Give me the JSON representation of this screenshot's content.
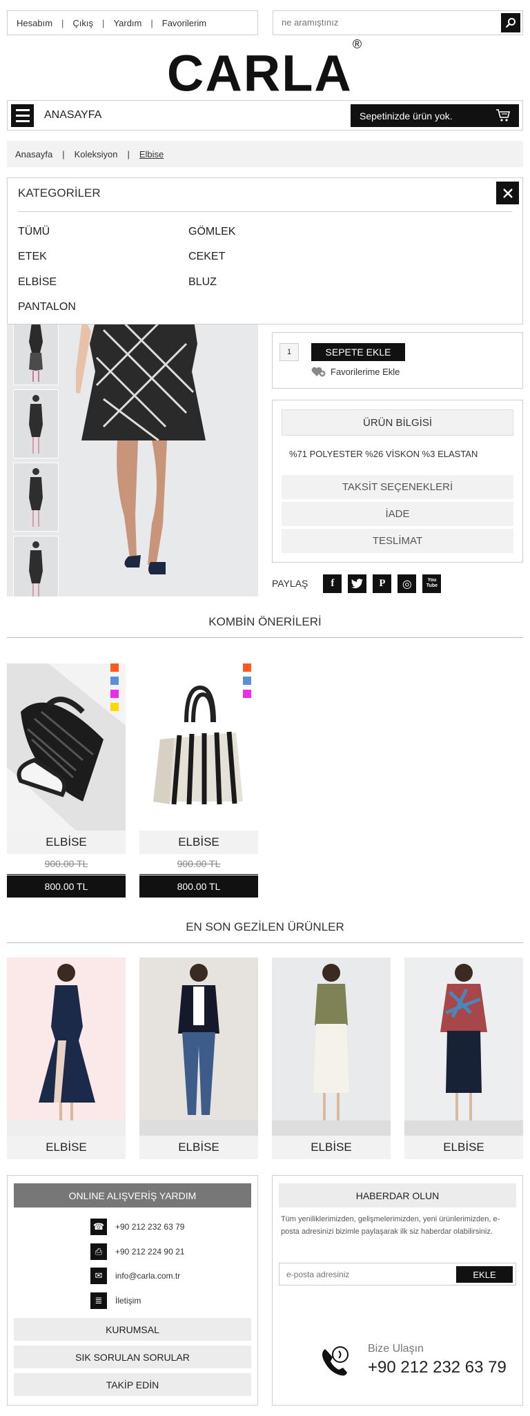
{
  "topnav": {
    "items": [
      "Hesabım",
      "Çıkış",
      "Yardım",
      "Favorilerim"
    ]
  },
  "search": {
    "placeholder": "ne aramıştınız"
  },
  "brand": {
    "logo": "CARLA",
    "reg": "®"
  },
  "navbar": {
    "home": "ANASAYFA",
    "cart": "Sepetinizde ürün yok."
  },
  "breadcrumb": {
    "items": [
      "Anasayfa",
      "Koleksiyon",
      "Elbise"
    ]
  },
  "categories": {
    "title": "KATEGORİLER",
    "items": [
      "TÜMÜ",
      "GÖMLEK",
      "ETEK",
      "CEKET",
      "ELBİSE",
      "BLUZ",
      "PANTALON"
    ]
  },
  "buy": {
    "qty": "1",
    "add": "SEPETE EKLE",
    "fav": "Favorilerime Ekle"
  },
  "info": {
    "title": "ÜRÜN BİLGİSİ",
    "composition": "%71 POLYESTER %26 VİSKON %3 ELASTAN",
    "rows": [
      "TAKSİT SEÇENEKLERİ",
      "İADE",
      "TESLİMAT"
    ]
  },
  "share": {
    "label": "PAYLAŞ",
    "icons": [
      "f",
      "t",
      "P",
      "◎",
      "You Tube"
    ]
  },
  "combo": {
    "title": "KOMBİN ÖNERİLERİ",
    "products": [
      {
        "name": "ELBİSE",
        "old_price": "900.00 TL",
        "price": "800.00 TL",
        "swatches": [
          "#ff5a1f",
          "#5b8fd6",
          "#e92ee9",
          "#ffd800"
        ]
      },
      {
        "name": "ELBİSE",
        "old_price": "900.00 TL",
        "price": "800.00 TL",
        "swatches": [
          "#ff5a1f",
          "#5b8fd6",
          "#e92ee9"
        ]
      }
    ]
  },
  "recent": {
    "title": "EN SON GEZİLEN ÜRÜNLER",
    "products": [
      {
        "name": "ELBİSE"
      },
      {
        "name": "ELBİSE"
      },
      {
        "name": "ELBİSE"
      },
      {
        "name": "ELBİSE"
      }
    ]
  },
  "help": {
    "title": "ONLINE ALIŞVERİŞ YARDIM",
    "phone": "+90 212 232 63 79",
    "fax": "+90 212 224 90 21",
    "email": "info@carla.com.tr",
    "contact": "İletişim",
    "links": [
      "KURUMSAL",
      "SIK SORULAN SORULAR",
      "TAKİP EDİN"
    ]
  },
  "newsletter": {
    "title": "HABERDAR OLUN",
    "text": "Tüm yeniliklerimizden, gelişmelerimizden, yeni ürünlerimizden, e-posta adresinizi bizimle paylaşarak ilk siz haberdar olabilirsiniz.",
    "placeholder": "e-posta adresiniz",
    "button": "EKLE",
    "call_label": "Bize Ulaşın",
    "call_number": "+90 212 232 63 79"
  }
}
